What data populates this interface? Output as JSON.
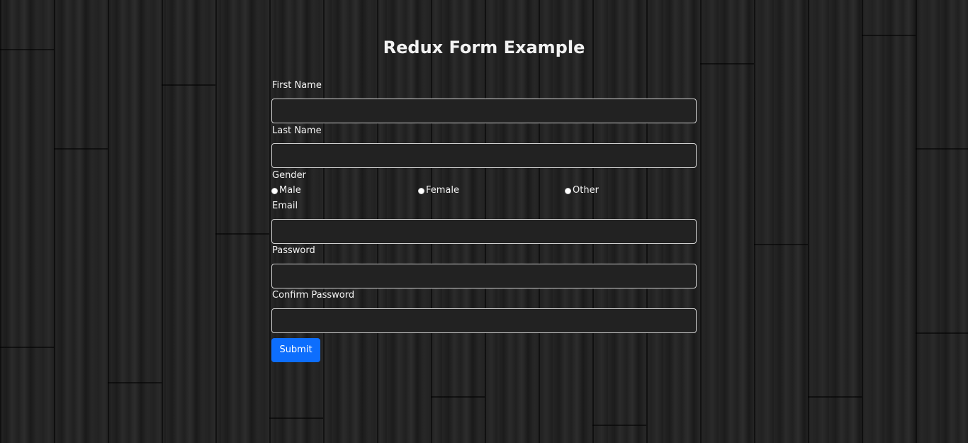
{
  "page": {
    "title": "Redux Form Example"
  },
  "form": {
    "first_name_label": "First Name",
    "first_name_value": "",
    "last_name_label": "Last Name",
    "last_name_value": "",
    "gender_label": "Gender",
    "gender_options": [
      "Male",
      "Female",
      "Other"
    ],
    "email_label": "Email",
    "email_value": "",
    "password_label": "Password",
    "password_value": "",
    "confirm_password_label": "Confirm Password",
    "confirm_password_value": "",
    "submit_label": "Submit"
  },
  "colors": {
    "accent": "#0d6efd",
    "input_bg": "#222222",
    "input_border": "#cfcfcf"
  }
}
